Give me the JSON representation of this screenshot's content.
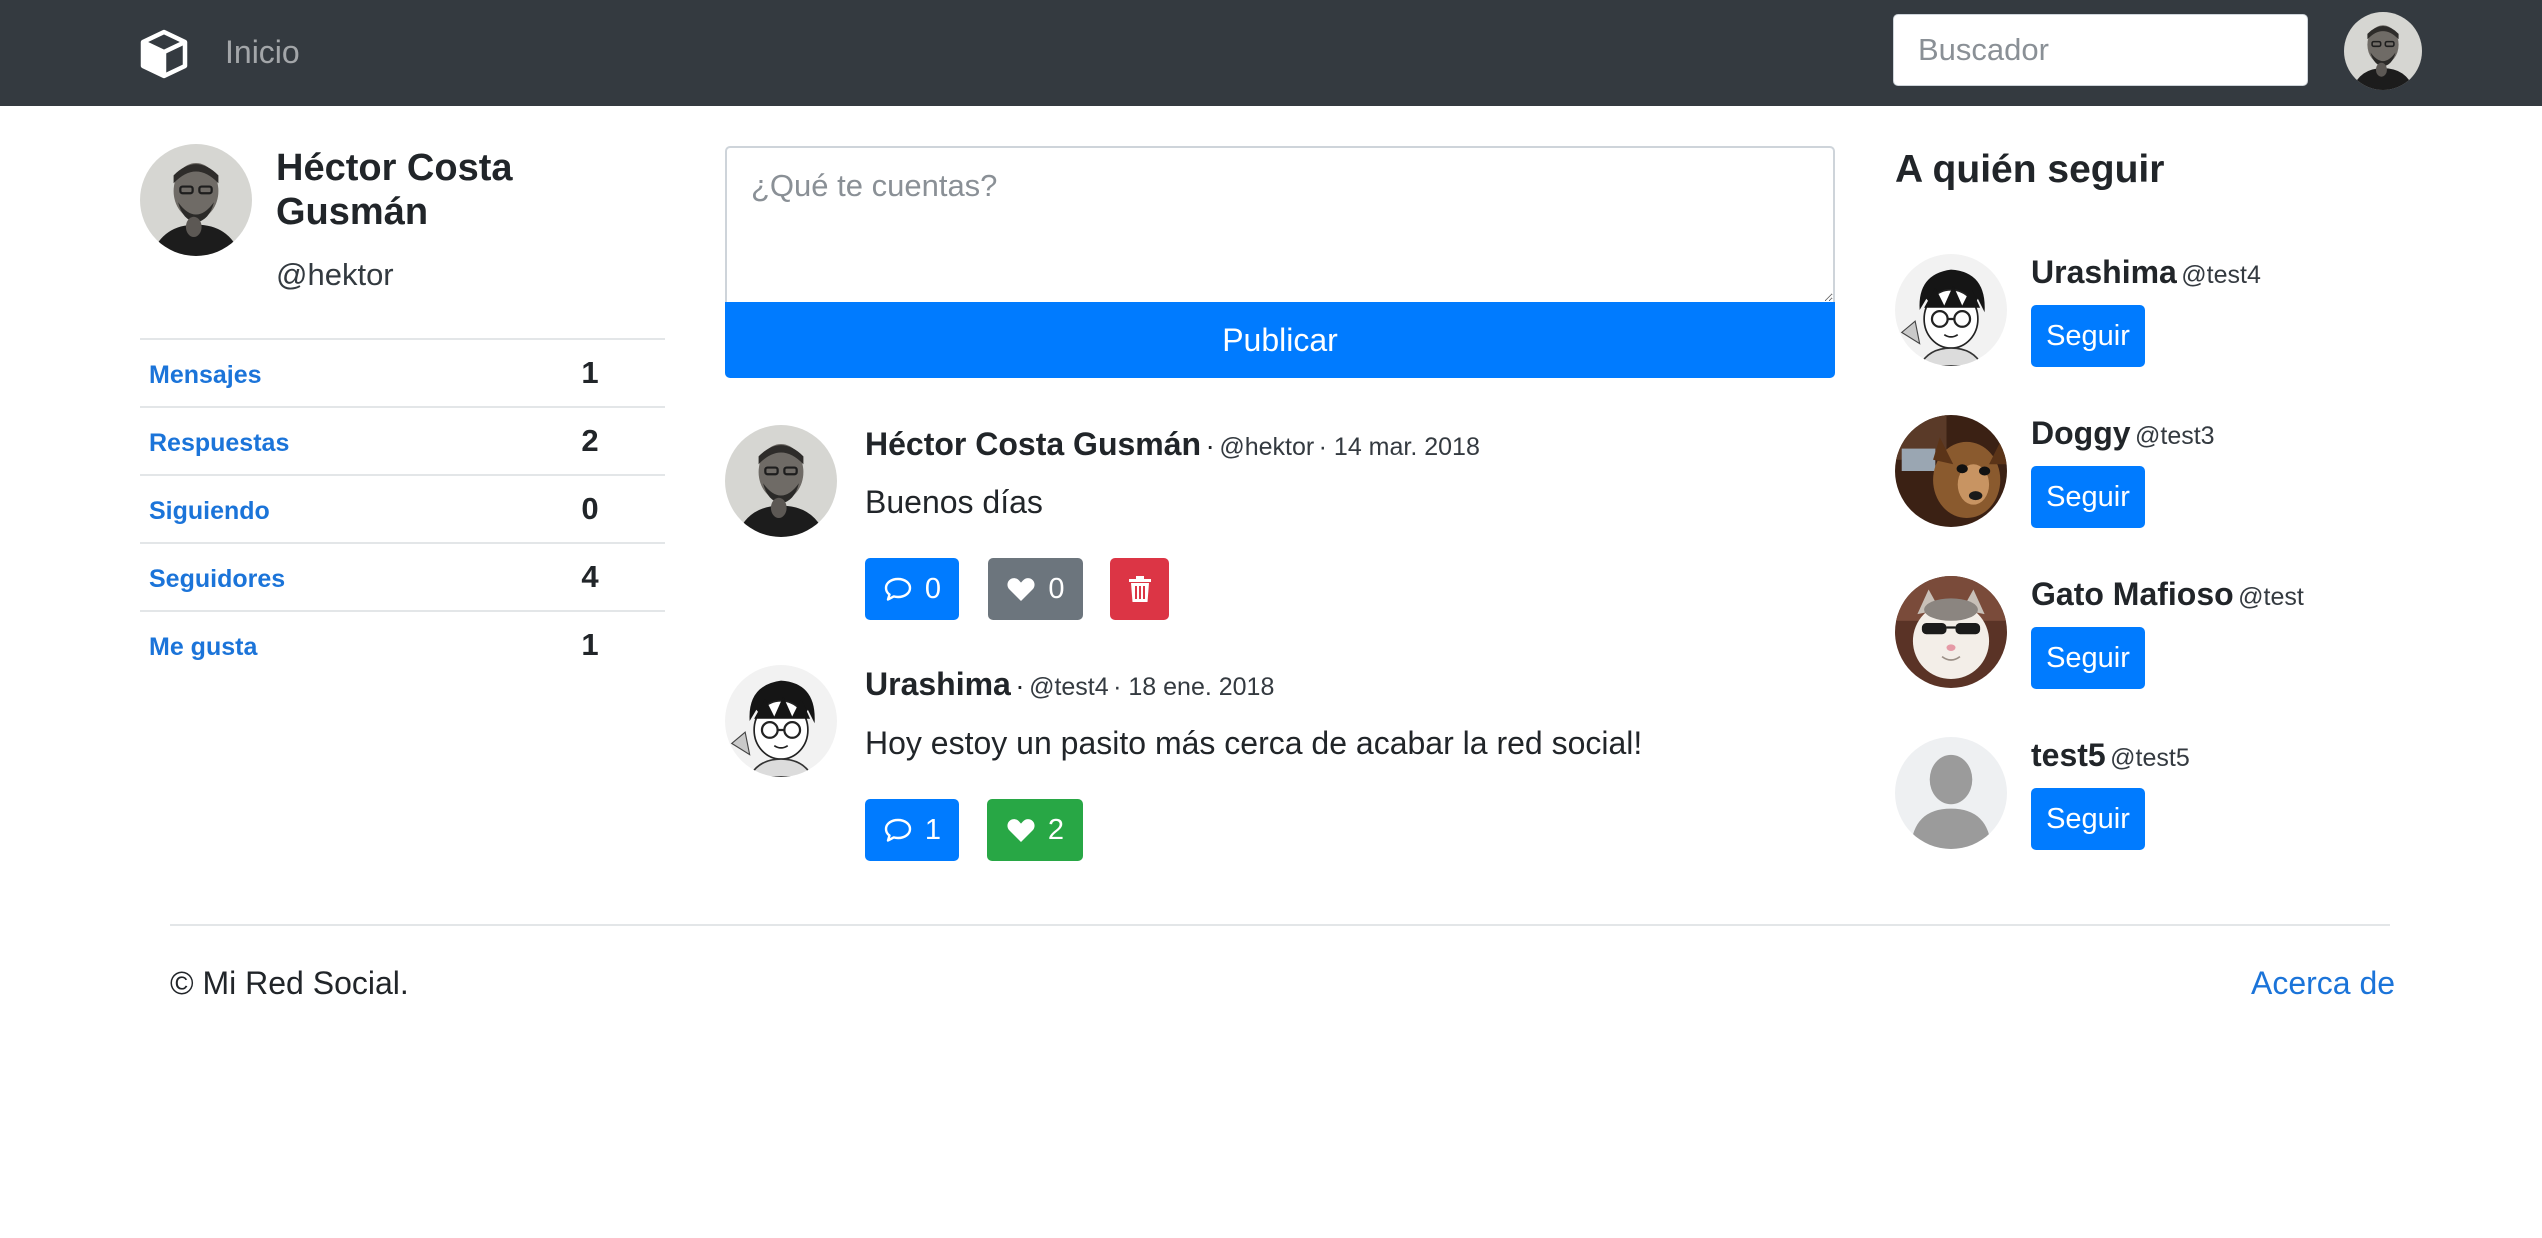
{
  "navbar": {
    "brand_icon": "cube-icon",
    "home_label": "Inicio",
    "search_placeholder": "Buscador"
  },
  "profile": {
    "name": "Héctor Costa Gusmán",
    "handle": "@hektor",
    "stats": [
      {
        "label": "Mensajes",
        "value": "1"
      },
      {
        "label": "Respuestas",
        "value": "2"
      },
      {
        "label": "Siguiendo",
        "value": "0"
      },
      {
        "label": "Seguidores",
        "value": "4"
      },
      {
        "label": "Me gusta",
        "value": "1"
      }
    ]
  },
  "compose": {
    "placeholder": "¿Qué te cuentas?",
    "publish_label": "Publicar"
  },
  "posts": [
    {
      "author": "Héctor Costa Gusmán",
      "separator": "·",
      "handle": "@hektor",
      "date": "· 14 mar. 2018",
      "text": "Buenos días",
      "replies": "0",
      "likes": "0",
      "liked": false,
      "can_delete": true
    },
    {
      "author": "Urashima",
      "separator": "·",
      "handle": "@test4",
      "date": "· 18 ene. 2018",
      "text": "Hoy estoy un pasito más cerca de acabar la red social!",
      "replies": "1",
      "likes": "2",
      "liked": true,
      "can_delete": false
    }
  ],
  "who_to_follow": {
    "title": "A quién seguir",
    "follow_label": "Seguir",
    "users": [
      {
        "name": "Urashima",
        "handle": "@test4"
      },
      {
        "name": "Doggy",
        "handle": "@test3"
      },
      {
        "name": "Gato Mafioso",
        "handle": "@test"
      },
      {
        "name": "test5",
        "handle": "@test5"
      }
    ]
  },
  "footer": {
    "copyright": "© Mi Red Social.",
    "about": "Acerca de"
  },
  "colors": {
    "navbar": "#343a40",
    "primary": "#007bff",
    "secondary": "#6c757d",
    "danger": "#dc3545",
    "success": "#28a745",
    "link": "#1b74d9"
  }
}
